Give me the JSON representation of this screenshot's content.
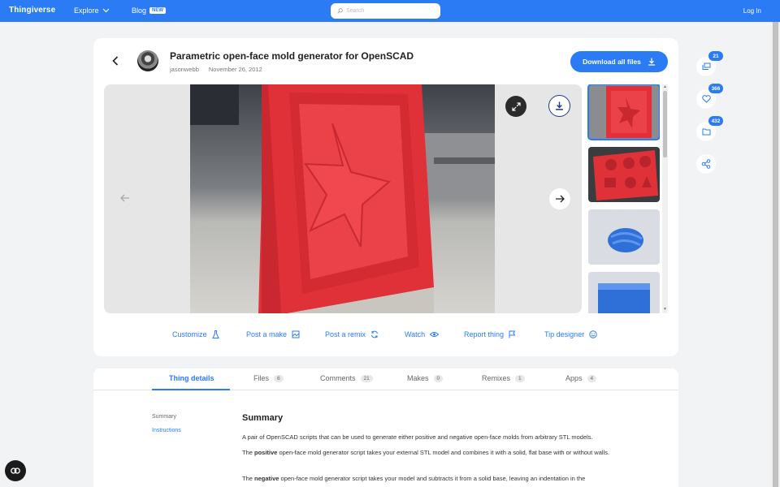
{
  "nav": {
    "logo": "Thingiverse",
    "explore": "Explore",
    "blog": "Blog",
    "blog_badge": "NEW",
    "search_placeholder": "Search",
    "login": "Log In"
  },
  "thing": {
    "title": "Parametric open-face mold generator for OpenSCAD",
    "author": "jasonwebb",
    "date": "November 26, 2012",
    "download_all": "Download all files"
  },
  "actions": {
    "customize": "Customize",
    "post_make": "Post a make",
    "post_remix": "Post a remix",
    "watch": "Watch",
    "report": "Report thing",
    "tip": "Tip designer"
  },
  "rail": {
    "collections": "21",
    "likes": "366",
    "remixes": "432"
  },
  "tabs": [
    {
      "label": "Thing details",
      "count": ""
    },
    {
      "label": "Files",
      "count": "6"
    },
    {
      "label": "Comments",
      "count": "21"
    },
    {
      "label": "Makes",
      "count": "0"
    },
    {
      "label": "Remixes",
      "count": "1"
    },
    {
      "label": "Apps",
      "count": "4"
    }
  ],
  "details": {
    "side_summary": "Summary",
    "side_instructions": "Instructions",
    "summary_title": "Summary",
    "p1": "A pair of OpenSCAD scripts that can be used to generate either positive and negative open-face molds from arbitrary STL models.",
    "p2_bold": "positive",
    "p2_pre": "The ",
    "p2_post": " open-face mold generator script takes your external STL model and combines it with a solid, flat base with or without walls.",
    "p3_bold": "negative",
    "p3_pre": "The ",
    "p3_post": " open-face mold generator script takes your model and subtracts it from a solid base, leaving an indentation in the"
  },
  "colors": {
    "brand": "#2a7bf4",
    "mold_red": "#e8353b"
  }
}
